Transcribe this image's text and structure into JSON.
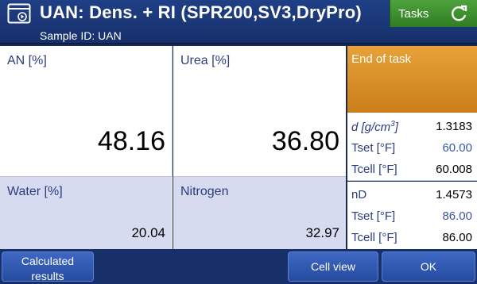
{
  "header": {
    "title": "UAN: Dens. + RI (SPR200,SV3,DryPro)",
    "sample_id": "Sample ID: UAN",
    "tasks_label": "Tasks",
    "icons": {
      "app": "app-window-icon",
      "refresh": "refresh-icon"
    }
  },
  "results": {
    "an": {
      "label": "AN [%]",
      "value": "48.16"
    },
    "urea": {
      "label": "Urea [%]",
      "value": "36.80"
    },
    "water": {
      "label": "Water [%]",
      "value": "20.04"
    },
    "nitrogen": {
      "label": "Nitrogen",
      "value": "32.97"
    }
  },
  "status": {
    "text": "End of task",
    "color": "#d98c28"
  },
  "density": {
    "d_label": "d [g/cm",
    "d_sup": "3",
    "d_label_end": "]",
    "d_value": "1.3183",
    "tset_label": "Tset [°F]",
    "tset_value": "60.00",
    "tcell_label": "Tcell [°F]",
    "tcell_value": "60.008"
  },
  "refraction": {
    "nd_label": "nD",
    "nd_value": "1.4573",
    "tset_label": "Tset [°F]",
    "tset_value": "86.00",
    "tcell_label": "Tcell [°F]",
    "tcell_value": "86.00"
  },
  "footer": {
    "calc_line1": "Calculated",
    "calc_line2": "results",
    "cell_view": "Cell view",
    "ok": "OK"
  },
  "colors": {
    "header": "#1f3f86",
    "tasks": "#3f9a32",
    "accent_blue": "#3a55a8",
    "panel": "#d7dbf0"
  }
}
